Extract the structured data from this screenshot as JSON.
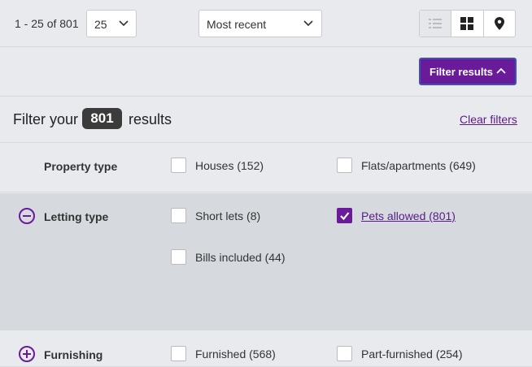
{
  "toolbar": {
    "result_range": "1 - 25 of 801",
    "per_page": "25",
    "sort": "Most recent",
    "views": [
      {
        "name": "list-view-icon",
        "active": true
      },
      {
        "name": "grid-view-icon",
        "active": false
      },
      {
        "name": "map-view-icon",
        "active": false
      }
    ]
  },
  "filter_toggle": {
    "label": "Filter results"
  },
  "summary": {
    "prefix": "Filter your",
    "count": "801",
    "suffix": "results",
    "clear_label": "Clear filters"
  },
  "sections": {
    "property_type": {
      "title": "Property type",
      "options": [
        {
          "label": "Houses (152)",
          "checked": false
        },
        {
          "label": "Flats/apartments (649)",
          "checked": false
        }
      ]
    },
    "letting_type": {
      "title": "Letting type",
      "expanded": true,
      "options": [
        {
          "label": "Short lets (8)",
          "checked": false
        },
        {
          "label": "Pets allowed (801)",
          "checked": true
        },
        {
          "label": "Bills included (44)",
          "checked": false
        }
      ]
    },
    "furnishing": {
      "title": "Furnishing",
      "expanded": false,
      "options": [
        {
          "label": "Furnished (568)",
          "checked": false
        },
        {
          "label": "Part-furnished (254)",
          "checked": false
        }
      ]
    }
  },
  "colors": {
    "accent": "#6a1b9a",
    "focus_ring": "#3f51b5"
  }
}
